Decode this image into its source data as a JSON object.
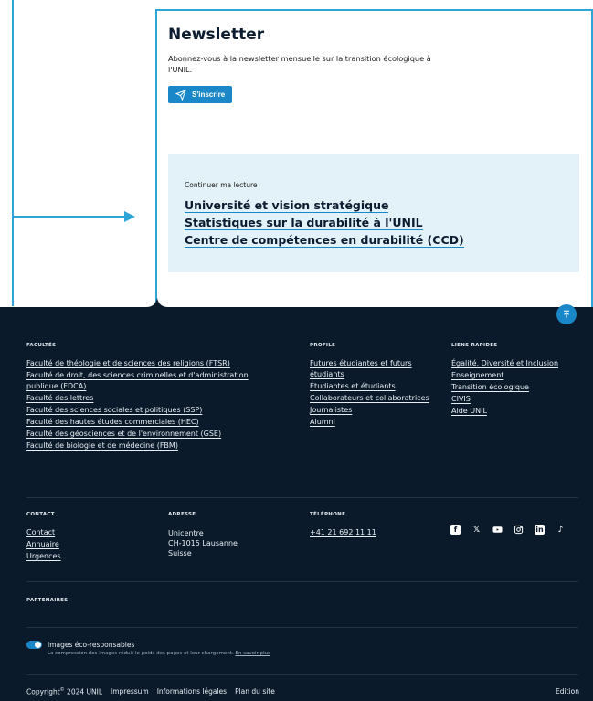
{
  "newsletter": {
    "title": "Newsletter",
    "description": "Abonnez-vous à la newsletter mensuelle sur la transition écologique à l'UNIL.",
    "button_label": "S'inscrire"
  },
  "reading": {
    "label": "Continuer ma lecture",
    "links": [
      "Université et vision stratégique",
      "Statistiques sur la durabilité à l'UNIL",
      "Centre de compétences en durabilité (CCD)"
    ]
  },
  "footer": {
    "facultes": {
      "heading": "FACULTÉS",
      "items": [
        "Faculté de théologie et de sciences des religions (FTSR)",
        "Faculté de droit, des sciences criminelles et d'administration publique (FDCA)",
        "Faculté des lettres",
        "Faculté des sciences sociales et politiques (SSP)",
        "Faculté des hautes études commerciales (HEC)",
        "Faculté des géosciences et de l'environnement (GSE)",
        "Faculté de biologie et de médecine (FBM)"
      ]
    },
    "profils": {
      "heading": "PROFILS",
      "items": [
        "Futures étudiantes et futurs étudiants",
        "Étudiantes et étudiants",
        "Collaborateurs et collaboratrices",
        "Journalistes",
        "Alumni"
      ]
    },
    "liens": {
      "heading": "LIENS RAPIDES",
      "items": [
        "Égalité, Diversité et Inclusion",
        "Enseignement",
        "Transition écologique",
        "CIVIS",
        "Aide UNIL"
      ]
    },
    "contact": {
      "heading": "CONTACT",
      "items": [
        "Contact",
        "Annuaire",
        "Urgences"
      ]
    },
    "adresse": {
      "heading": "ADRESSE",
      "lines": [
        "Unicentre",
        "CH-1015 Lausanne",
        "Suisse"
      ]
    },
    "telephone": {
      "heading": "TÉLÉPHONE",
      "number": "+41 21 692 11 11"
    },
    "socials": [
      "facebook-icon",
      "x-icon",
      "youtube-icon",
      "instagram-icon",
      "linkedin-icon",
      "tiktok-icon"
    ],
    "partenaires": {
      "heading": "PARTENAIRES"
    },
    "eco": {
      "title": "Images éco-responsables",
      "description": "La compression des images réduit le poids des pages et leur chargement.",
      "link": "En savoir plus",
      "enabled": true
    },
    "bottom": {
      "copyright": "Copyright",
      "copyright_year": "2024 UNIL",
      "links": [
        "Impressum",
        "Informations légales",
        "Plan du site"
      ],
      "edition": "Edition"
    }
  },
  "colors": {
    "accent": "#1a88c8",
    "frame": "#2fa4d6",
    "footer_bg": "#0a1a2b",
    "reading_bg": "#e3f1f8"
  }
}
